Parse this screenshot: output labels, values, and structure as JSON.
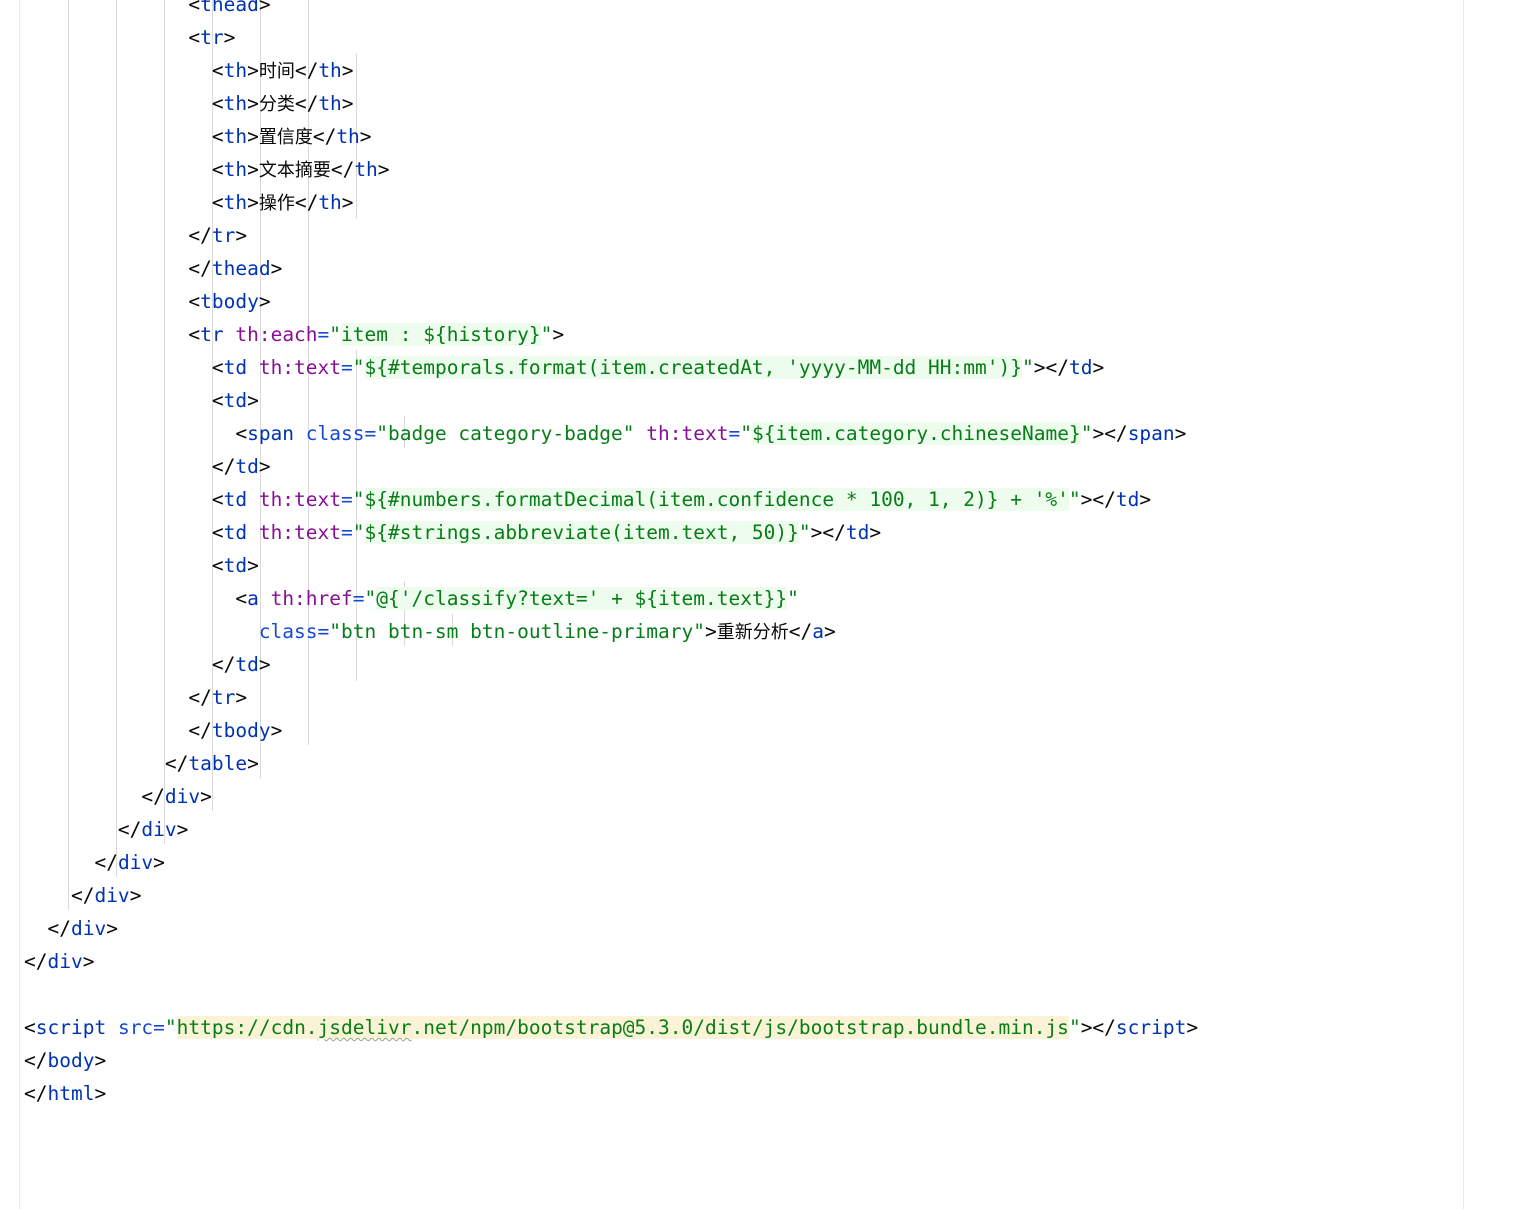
{
  "editor": {
    "language": "html",
    "lines": [
      {
        "indent": 14,
        "tokens": [
          [
            "t-br",
            "<"
          ],
          [
            "t-tag",
            "thead"
          ],
          [
            "t-br",
            ">"
          ]
        ]
      },
      {
        "indent": 14,
        "tokens": [
          [
            "t-br",
            "<"
          ],
          [
            "t-tag",
            "tr"
          ],
          [
            "t-br",
            ">"
          ]
        ]
      },
      {
        "indent": 16,
        "tokens": [
          [
            "t-br",
            "<"
          ],
          [
            "t-tag",
            "th"
          ],
          [
            "t-br",
            ">"
          ],
          [
            "t-txt cjk",
            "时间"
          ],
          [
            "t-br",
            "</"
          ],
          [
            "t-tag",
            "th"
          ],
          [
            "t-br",
            ">"
          ]
        ]
      },
      {
        "indent": 16,
        "tokens": [
          [
            "t-br",
            "<"
          ],
          [
            "t-tag",
            "th"
          ],
          [
            "t-br",
            ">"
          ],
          [
            "t-txt cjk",
            "分类"
          ],
          [
            "t-br",
            "</"
          ],
          [
            "t-tag",
            "th"
          ],
          [
            "t-br",
            ">"
          ]
        ]
      },
      {
        "indent": 16,
        "tokens": [
          [
            "t-br",
            "<"
          ],
          [
            "t-tag",
            "th"
          ],
          [
            "t-br",
            ">"
          ],
          [
            "t-txt cjk",
            "置信度"
          ],
          [
            "t-br",
            "</"
          ],
          [
            "t-tag",
            "th"
          ],
          [
            "t-br",
            ">"
          ]
        ]
      },
      {
        "indent": 16,
        "tokens": [
          [
            "t-br",
            "<"
          ],
          [
            "t-tag",
            "th"
          ],
          [
            "t-br",
            ">"
          ],
          [
            "t-txt cjk",
            "文本摘要"
          ],
          [
            "t-br",
            "</"
          ],
          [
            "t-tag",
            "th"
          ],
          [
            "t-br",
            ">"
          ]
        ]
      },
      {
        "indent": 16,
        "tokens": [
          [
            "t-br",
            "<"
          ],
          [
            "t-tag",
            "th"
          ],
          [
            "t-br",
            ">"
          ],
          [
            "t-txt cjk",
            "操作"
          ],
          [
            "t-br",
            "</"
          ],
          [
            "t-tag",
            "th"
          ],
          [
            "t-br",
            ">"
          ]
        ]
      },
      {
        "indent": 14,
        "tokens": [
          [
            "t-br",
            "</"
          ],
          [
            "t-tag",
            "tr"
          ],
          [
            "t-br",
            ">"
          ]
        ]
      },
      {
        "indent": 14,
        "tokens": [
          [
            "t-br",
            "</"
          ],
          [
            "t-tag",
            "thead"
          ],
          [
            "t-br",
            ">"
          ]
        ]
      },
      {
        "indent": 14,
        "tokens": [
          [
            "t-br",
            "<"
          ],
          [
            "t-tag",
            "tbody"
          ],
          [
            "t-br",
            ">"
          ]
        ]
      },
      {
        "indent": 14,
        "tokens": [
          [
            "t-br",
            "<"
          ],
          [
            "t-tag",
            "tr"
          ],
          [
            "t-br",
            " "
          ],
          [
            "t-th",
            "th:each"
          ],
          [
            "t-attr",
            "="
          ],
          [
            "t-str",
            "\""
          ],
          [
            "t-hl",
            "item : ${history}"
          ],
          [
            "t-str",
            "\""
          ],
          [
            "t-br",
            ">"
          ]
        ]
      },
      {
        "indent": 16,
        "tokens": [
          [
            "t-br",
            "<"
          ],
          [
            "t-tag",
            "td"
          ],
          [
            "t-br",
            " "
          ],
          [
            "t-th",
            "th:text"
          ],
          [
            "t-attr",
            "="
          ],
          [
            "t-str",
            "\""
          ],
          [
            "t-hl",
            "${#temporals.format(item.createdAt, 'yyyy-MM-dd HH:mm')}"
          ],
          [
            "t-str",
            "\""
          ],
          [
            "t-br",
            "></"
          ],
          [
            "t-tag",
            "td"
          ],
          [
            "t-br",
            ">"
          ]
        ]
      },
      {
        "indent": 16,
        "tokens": [
          [
            "t-br",
            "<"
          ],
          [
            "t-tag",
            "td"
          ],
          [
            "t-br",
            ">"
          ]
        ]
      },
      {
        "indent": 18,
        "tokens": [
          [
            "t-br",
            "<"
          ],
          [
            "t-tag",
            "span"
          ],
          [
            "t-br",
            " "
          ],
          [
            "t-attr",
            "class="
          ],
          [
            "t-str",
            "\"badge category-badge\""
          ],
          [
            "t-br",
            " "
          ],
          [
            "t-th",
            "th:text"
          ],
          [
            "t-attr",
            "="
          ],
          [
            "t-str",
            "\""
          ],
          [
            "t-hl",
            "${item.category.chineseName}"
          ],
          [
            "t-str",
            "\""
          ],
          [
            "t-br",
            "></"
          ],
          [
            "t-tag",
            "span"
          ],
          [
            "t-br",
            ">"
          ]
        ]
      },
      {
        "indent": 16,
        "tokens": [
          [
            "t-br",
            "</"
          ],
          [
            "t-tag",
            "td"
          ],
          [
            "t-br",
            ">"
          ]
        ]
      },
      {
        "indent": 16,
        "tokens": [
          [
            "t-br",
            "<"
          ],
          [
            "t-tag",
            "td"
          ],
          [
            "t-br",
            " "
          ],
          [
            "t-th",
            "th:text"
          ],
          [
            "t-attr",
            "="
          ],
          [
            "t-str",
            "\""
          ],
          [
            "t-hl",
            "${#numbers.formatDecimal(item.confidence * 100, 1, 2)} + '%'"
          ],
          [
            "t-str",
            "\""
          ],
          [
            "t-br",
            "></"
          ],
          [
            "t-tag",
            "td"
          ],
          [
            "t-br",
            ">"
          ]
        ]
      },
      {
        "indent": 16,
        "tokens": [
          [
            "t-br",
            "<"
          ],
          [
            "t-tag",
            "td"
          ],
          [
            "t-br",
            " "
          ],
          [
            "t-th",
            "th:text"
          ],
          [
            "t-attr",
            "="
          ],
          [
            "t-str",
            "\""
          ],
          [
            "t-hl",
            "${#strings.abbreviate(item.text, 50)}"
          ],
          [
            "t-str",
            "\""
          ],
          [
            "t-br",
            "></"
          ],
          [
            "t-tag",
            "td"
          ],
          [
            "t-br",
            ">"
          ]
        ]
      },
      {
        "indent": 16,
        "tokens": [
          [
            "t-br",
            "<"
          ],
          [
            "t-tag",
            "td"
          ],
          [
            "t-br",
            ">"
          ]
        ]
      },
      {
        "indent": 18,
        "tokens": [
          [
            "t-br",
            "<"
          ],
          [
            "t-tag",
            "a"
          ],
          [
            "t-br",
            " "
          ],
          [
            "t-th",
            "th:href"
          ],
          [
            "t-attr",
            "="
          ],
          [
            "t-str",
            "\""
          ],
          [
            "t-hl",
            "@{'/classify?text=' + ${item.text}}"
          ],
          [
            "t-str",
            "\""
          ]
        ]
      },
      {
        "indent": 20,
        "tokens": [
          [
            "t-attr",
            "class="
          ],
          [
            "t-str",
            "\"btn btn-sm btn-outline-primary\""
          ],
          [
            "t-br",
            ">"
          ],
          [
            "t-txt cjk",
            "重新分析"
          ],
          [
            "t-br",
            "</"
          ],
          [
            "t-tag",
            "a"
          ],
          [
            "t-br",
            ">"
          ]
        ]
      },
      {
        "indent": 16,
        "tokens": [
          [
            "t-br",
            "</"
          ],
          [
            "t-tag",
            "td"
          ],
          [
            "t-br",
            ">"
          ]
        ]
      },
      {
        "indent": 14,
        "tokens": [
          [
            "t-br",
            "</"
          ],
          [
            "t-tag",
            "tr"
          ],
          [
            "t-br",
            ">"
          ]
        ]
      },
      {
        "indent": 14,
        "tokens": [
          [
            "t-br",
            "</"
          ],
          [
            "t-tag",
            "tbody"
          ],
          [
            "t-br",
            ">"
          ]
        ]
      },
      {
        "indent": 12,
        "tokens": [
          [
            "t-br",
            "</"
          ],
          [
            "t-tag",
            "table"
          ],
          [
            "t-br",
            ">"
          ]
        ]
      },
      {
        "indent": 10,
        "tokens": [
          [
            "t-br",
            "</"
          ],
          [
            "t-tag",
            "div"
          ],
          [
            "t-br",
            ">"
          ]
        ]
      },
      {
        "indent": 8,
        "tokens": [
          [
            "t-br",
            "</"
          ],
          [
            "t-tag",
            "div"
          ],
          [
            "t-br",
            ">"
          ]
        ]
      },
      {
        "indent": 6,
        "tokens": [
          [
            "t-br",
            "</"
          ],
          [
            "t-tag",
            "div"
          ],
          [
            "t-br",
            ">"
          ]
        ]
      },
      {
        "indent": 4,
        "tokens": [
          [
            "t-br",
            "</"
          ],
          [
            "t-tag",
            "div"
          ],
          [
            "t-br",
            ">"
          ]
        ]
      },
      {
        "indent": 2,
        "tokens": [
          [
            "t-br",
            "</"
          ],
          [
            "t-tag",
            "div"
          ],
          [
            "t-br",
            ">"
          ]
        ]
      },
      {
        "indent": 0,
        "tokens": [
          [
            "t-br",
            "</"
          ],
          [
            "t-tag",
            "div"
          ],
          [
            "t-br",
            ">"
          ]
        ]
      },
      {
        "indent": 0,
        "tokens": []
      },
      {
        "indent": 0,
        "tokens": [
          [
            "t-br",
            "<"
          ],
          [
            "t-tag",
            "script"
          ],
          [
            "t-br",
            " "
          ],
          [
            "t-attr",
            "src="
          ],
          [
            "t-str",
            "\""
          ],
          [
            "t-url",
            "https://cdn."
          ],
          [
            "t-urlw",
            "jsdelivr"
          ],
          [
            "t-url",
            ".net/npm/bootstrap@5.3.0/dist/js/bootstrap.bundle.min.js"
          ],
          [
            "t-str",
            "\""
          ],
          [
            "t-br",
            "></"
          ],
          [
            "t-tag",
            "script"
          ],
          [
            "t-br",
            ">"
          ]
        ]
      },
      {
        "indent": 0,
        "tokens": [
          [
            "t-br",
            "</"
          ],
          [
            "t-tag",
            "body"
          ],
          [
            "t-br",
            ">"
          ]
        ]
      },
      {
        "indent": 0,
        "tokens": [
          [
            "t-br",
            "</"
          ],
          [
            "t-tag",
            "html"
          ],
          [
            "t-br",
            ">"
          ]
        ]
      }
    ]
  }
}
